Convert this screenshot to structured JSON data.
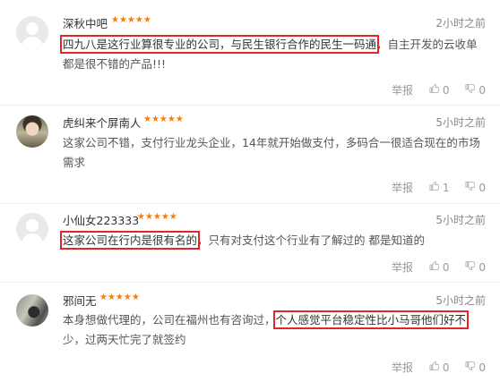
{
  "icons": {
    "star": "star-icon",
    "like": "thumb-up-icon",
    "dislike": "thumb-down-icon"
  },
  "colors": {
    "stars": "#ff7a00",
    "highlight_box": "#e5232b"
  },
  "comments": [
    {
      "user": "深秋中吧",
      "stars": "★★★★★",
      "time": "2小时之前",
      "text_highlight": "四九八是这行业算很专业的公司，与民生银行合作的民生一码通",
      "text_rest": "，自主开发的云收单都是很不错的产品!!!",
      "report": "举报",
      "likes": "0",
      "dislikes": "0"
    },
    {
      "user": "虎纠来个屏南人",
      "stars": "★★★★★",
      "time": "5小时之前",
      "text": "这家公司不错，支付行业龙头企业，14年就开始做支付，多码合一很适合现在的市场需求",
      "report": "举报",
      "likes": "1",
      "dislikes": "0"
    },
    {
      "user": "小仙女223333",
      "stars": "★★★★★",
      "time": "5小时之前",
      "text_highlight": "这家公司在行内是很有名的",
      "text_rest": "，只有对支付这个行业有了解过的 都是知道的",
      "report": "举报",
      "likes": "0",
      "dislikes": "0"
    },
    {
      "user": "邪间无",
      "stars": "★★★★★",
      "time": "5小时之前",
      "text_pre": "本身想做代理的，公司在福州也有咨询过，",
      "text_highlight": "个人感觉平台稳定性比小马哥他们好不",
      "text_rest": "少，过两天忙完了就签约",
      "report": "举报",
      "likes": "0",
      "dislikes": "0"
    }
  ]
}
